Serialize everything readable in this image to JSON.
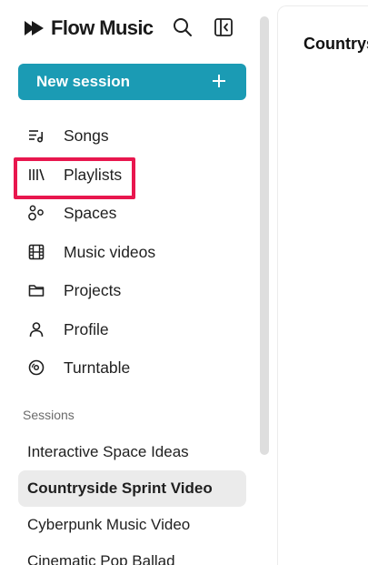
{
  "app": {
    "name": "Flow Music"
  },
  "header": {
    "search_icon": "search-icon",
    "collapse_icon": "sidebar-collapse-icon"
  },
  "new_session": {
    "label": "New session",
    "icon": "plus-icon"
  },
  "nav": {
    "items": [
      {
        "label": "Songs",
        "icon": "songs-list-icon"
      },
      {
        "label": "Playlists",
        "icon": "library-icon"
      },
      {
        "label": "Spaces",
        "icon": "spaces-icon"
      },
      {
        "label": "Music videos",
        "icon": "film-icon"
      },
      {
        "label": "Projects",
        "icon": "folder-icon"
      },
      {
        "label": "Profile",
        "icon": "person-icon"
      },
      {
        "label": "Turntable",
        "icon": "turntable-icon"
      }
    ],
    "highlighted": "Playlists"
  },
  "sessions": {
    "title": "Sessions",
    "items": [
      {
        "label": "Interactive Space Ideas",
        "active": false
      },
      {
        "label": "Countryside Sprint Video",
        "active": true
      },
      {
        "label": "Cyberpunk Music Video",
        "active": false
      },
      {
        "label": "Cinematic Pop Ballad",
        "active": false
      }
    ]
  },
  "main": {
    "title": "Countryside Sprint Video"
  },
  "colors": {
    "accent": "#1b9bb4",
    "highlight": "#e8174e",
    "active_session_bg": "#ebebeb"
  }
}
